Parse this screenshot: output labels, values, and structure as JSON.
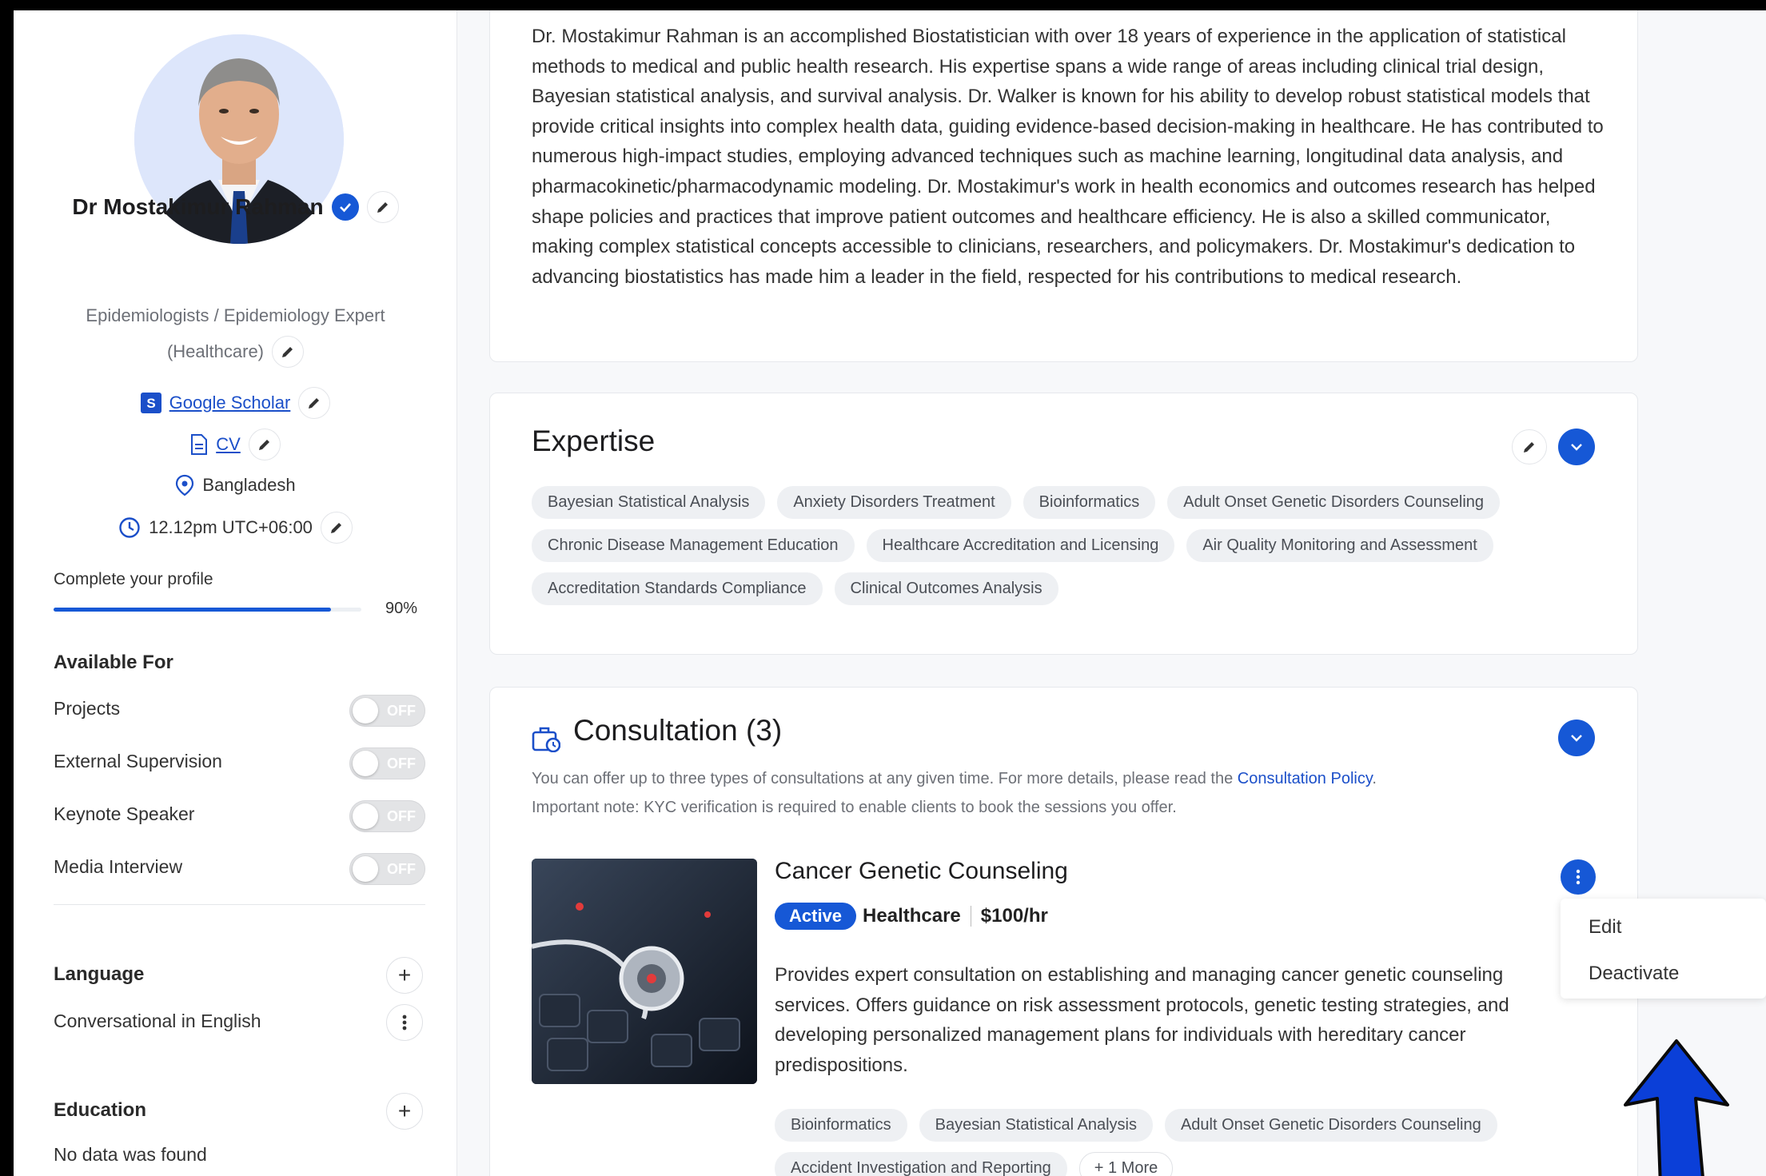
{
  "profile": {
    "name": "Dr Mostakimur Rahman",
    "title_line1": "Epidemiologists / Epidemiology Expert",
    "title_line2": "(Healthcare)",
    "google_scholar": "Google Scholar",
    "cv": "CV",
    "location": "Bangladesh",
    "time": "12.12pm UTC+06:00"
  },
  "completion": {
    "label": "Complete your profile",
    "percent_text": "90%",
    "value": 0.9
  },
  "available_for": {
    "heading": "Available For",
    "items": [
      {
        "label": "Projects",
        "state": "OFF"
      },
      {
        "label": "External Supervision",
        "state": "OFF"
      },
      {
        "label": "Keynote Speaker",
        "state": "OFF"
      },
      {
        "label": "Media Interview",
        "state": "OFF"
      }
    ]
  },
  "language": {
    "heading": "Language",
    "item": "Conversational in English"
  },
  "education": {
    "heading": "Education",
    "empty": "No data was found"
  },
  "bio": "Dr. Mostakimur Rahman is an accomplished Biostatistician with over 18 years of experience in the application of statistical methods to medical and public health research. His expertise spans a wide range of areas including clinical trial design, Bayesian statistical analysis, and survival analysis. Dr. Walker is known for his ability to develop robust statistical models that provide critical insights into complex health data, guiding evidence-based decision-making in healthcare. He has contributed to numerous high-impact studies, employing advanced techniques such as machine learning, longitudinal data analysis, and pharmacokinetic/pharmacodynamic modeling. Dr. Mostakimur's work in health economics and outcomes research has helped shape policies and practices that improve patient outcomes and healthcare efficiency. He is also a skilled communicator, making complex statistical concepts accessible to clinicians, researchers, and policymakers. Dr. Mostakimur's dedication to advancing biostatistics has made him a leader in the field, respected for his contributions to medical research.",
  "expertise": {
    "heading": "Expertise",
    "tags": [
      "Bayesian Statistical Analysis",
      "Anxiety Disorders Treatment",
      "Bioinformatics",
      "Adult Onset Genetic Disorders Counseling",
      "Chronic Disease Management Education",
      "Healthcare Accreditation and Licensing",
      "Air Quality Monitoring and Assessment",
      "Accreditation Standards Compliance",
      "Clinical Outcomes Analysis"
    ]
  },
  "consultation": {
    "heading": "Consultation (3)",
    "note_prefix": "You can offer up to three types of consultations at any given time. For more details, please read the ",
    "note_link": "Consultation Policy",
    "note_suffix": ".",
    "note2": "Important note: KYC verification is required to enable clients to book the sessions you offer.",
    "item": {
      "title": "Cancer Genetic Counseling",
      "status": "Active",
      "category": "Healthcare",
      "price": "$100/hr",
      "description": "Provides expert consultation on establishing and managing cancer genetic counseling services. Offers guidance on risk assessment protocols, genetic testing strategies, and developing personalized management plans for individuals with hereditary cancer predispositions.",
      "tags": [
        "Bioinformatics",
        "Bayesian Statistical Analysis",
        "Adult Onset Genetic Disorders Counseling",
        "Accident Investigation and Reporting"
      ],
      "more": "+ 1 More"
    },
    "menu": {
      "edit": "Edit",
      "deactivate": "Deactivate"
    }
  },
  "colors": {
    "accent": "#1658d6",
    "arrow": "#0b3fd8",
    "tag_bg": "#eef0f3"
  },
  "icons": [
    "verified-icon",
    "pencil-icon",
    "google-scholar-icon",
    "document-icon",
    "location-pin-icon",
    "clock-icon",
    "plus-icon",
    "kebab-icon",
    "chevron-down-icon",
    "briefcase-clock-icon",
    "annotation-arrow-icon"
  ]
}
